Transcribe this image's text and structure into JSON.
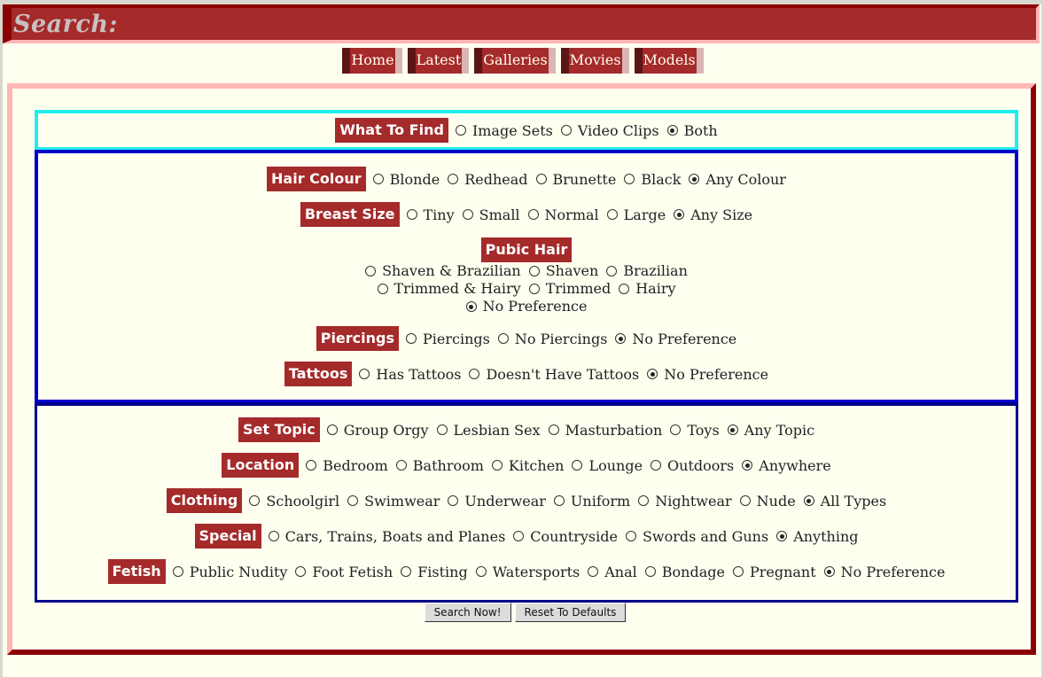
{
  "header": {
    "title": "Search:"
  },
  "nav": [
    {
      "label": "Home"
    },
    {
      "label": "Latest"
    },
    {
      "label": "Galleries"
    },
    {
      "label": "Movies"
    },
    {
      "label": "Models"
    }
  ],
  "what_to_find": {
    "label": "What To Find",
    "options": [
      {
        "label": "Image Sets",
        "checked": false
      },
      {
        "label": "Video Clips",
        "checked": false
      },
      {
        "label": "Both",
        "checked": true
      }
    ]
  },
  "hair_colour": {
    "label": "Hair Colour",
    "options": [
      {
        "label": "Blonde",
        "checked": false
      },
      {
        "label": "Redhead",
        "checked": false
      },
      {
        "label": "Brunette",
        "checked": false
      },
      {
        "label": "Black",
        "checked": false
      },
      {
        "label": "Any Colour",
        "checked": true
      }
    ]
  },
  "breast_size": {
    "label": "Breast Size",
    "options": [
      {
        "label": "Tiny",
        "checked": false
      },
      {
        "label": "Small",
        "checked": false
      },
      {
        "label": "Normal",
        "checked": false
      },
      {
        "label": "Large",
        "checked": false
      },
      {
        "label": "Any Size",
        "checked": true
      }
    ]
  },
  "pubic_hair": {
    "label": "Pubic Hair",
    "lines": [
      [
        {
          "label": "Shaven & Brazilian",
          "checked": false
        },
        {
          "label": "Shaven",
          "checked": false
        },
        {
          "label": "Brazilian",
          "checked": false
        }
      ],
      [
        {
          "label": "Trimmed & Hairy",
          "checked": false
        },
        {
          "label": "Trimmed",
          "checked": false
        },
        {
          "label": "Hairy",
          "checked": false
        }
      ],
      [
        {
          "label": "No Preference",
          "checked": true
        }
      ]
    ]
  },
  "piercings": {
    "label": "Piercings",
    "options": [
      {
        "label": "Piercings",
        "checked": false
      },
      {
        "label": "No Piercings",
        "checked": false
      },
      {
        "label": "No Preference",
        "checked": true
      }
    ]
  },
  "tattoos": {
    "label": "Tattoos",
    "options": [
      {
        "label": "Has Tattoos",
        "checked": false
      },
      {
        "label": "Doesn't Have Tattoos",
        "checked": false
      },
      {
        "label": "No Preference",
        "checked": true
      }
    ]
  },
  "set_topic": {
    "label": "Set Topic",
    "options": [
      {
        "label": "Group Orgy",
        "checked": false
      },
      {
        "label": "Lesbian Sex",
        "checked": false
      },
      {
        "label": "Masturbation",
        "checked": false
      },
      {
        "label": "Toys",
        "checked": false
      },
      {
        "label": "Any Topic",
        "checked": true
      }
    ]
  },
  "location": {
    "label": "Location",
    "options": [
      {
        "label": "Bedroom",
        "checked": false
      },
      {
        "label": "Bathroom",
        "checked": false
      },
      {
        "label": "Kitchen",
        "checked": false
      },
      {
        "label": "Lounge",
        "checked": false
      },
      {
        "label": "Outdoors",
        "checked": false
      },
      {
        "label": "Anywhere",
        "checked": true
      }
    ]
  },
  "clothing": {
    "label": "Clothing",
    "options": [
      {
        "label": "Schoolgirl",
        "checked": false
      },
      {
        "label": "Swimwear",
        "checked": false
      },
      {
        "label": "Underwear",
        "checked": false
      },
      {
        "label": "Uniform",
        "checked": false
      },
      {
        "label": "Nightwear",
        "checked": false
      },
      {
        "label": "Nude",
        "checked": false
      },
      {
        "label": "All Types",
        "checked": true
      }
    ]
  },
  "special": {
    "label": "Special",
    "options": [
      {
        "label": "Cars, Trains, Boats and Planes",
        "checked": false
      },
      {
        "label": "Countryside",
        "checked": false
      },
      {
        "label": "Swords and Guns",
        "checked": false
      },
      {
        "label": "Anything",
        "checked": true
      }
    ]
  },
  "fetish": {
    "label": "Fetish",
    "options": [
      {
        "label": "Public Nudity",
        "checked": false
      },
      {
        "label": "Foot Fetish",
        "checked": false
      },
      {
        "label": "Fisting",
        "checked": false
      },
      {
        "label": "Watersports",
        "checked": false
      },
      {
        "label": "Anal",
        "checked": false
      },
      {
        "label": "Bondage",
        "checked": false
      },
      {
        "label": "Pregnant",
        "checked": false
      },
      {
        "label": "No Preference",
        "checked": true
      }
    ]
  },
  "buttons": {
    "search": "Search Now!",
    "reset": "Reset To Defaults"
  }
}
